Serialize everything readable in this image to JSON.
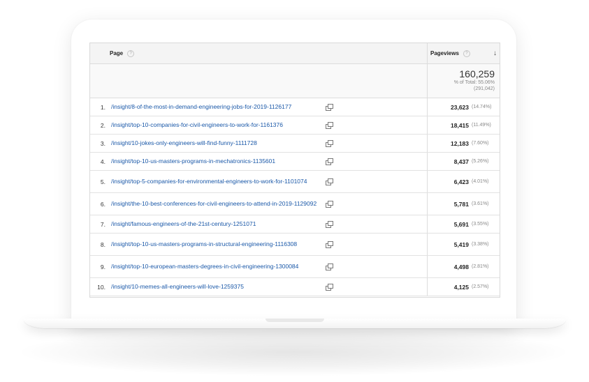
{
  "table": {
    "header": {
      "page_label": "Page",
      "metric_label": "Pageviews",
      "help_glyph": "?",
      "sort_glyph": "↓"
    },
    "total": {
      "value": "160,259",
      "percent_line": "% of Total: 55.06%",
      "total_line": "(291,042)"
    },
    "rows": [
      {
        "index": "1.",
        "page": "/insight/8-of-the-most-in-demand-engineering-jobs-for-2019-1126177",
        "views": "23,623",
        "pct": "(14.74%)"
      },
      {
        "index": "2.",
        "page": "/insight/top-10-companies-for-civil-engineers-to-work-for-1161376",
        "views": "18,415",
        "pct": "(11.49%)"
      },
      {
        "index": "3.",
        "page": "/insight/10-jokes-only-engineers-will-find-funny-1111728",
        "views": "12,183",
        "pct": "(7.60%)"
      },
      {
        "index": "4.",
        "page": "/insight/top-10-us-masters-programs-in-mechatronics-1135601",
        "views": "8,437",
        "pct": "(5.26%)"
      },
      {
        "index": "5.",
        "page": "/insight/top-5-companies-for-environmental-engineers-to-work-for-1101074",
        "views": "6,423",
        "pct": "(4.01%)"
      },
      {
        "index": "6.",
        "page": "/insight/the-10-best-conferences-for-civil-engineers-to-attend-in-2019-1129092",
        "views": "5,781",
        "pct": "(3.61%)"
      },
      {
        "index": "7.",
        "page": "/insight/famous-engineers-of-the-21st-century-1251071",
        "views": "5,691",
        "pct": "(3.55%)"
      },
      {
        "index": "8.",
        "page": "/insight/top-10-us-masters-programs-in-structural-engineering-1116308",
        "views": "5,419",
        "pct": "(3.38%)"
      },
      {
        "index": "9.",
        "page": "/insight/top-10-european-masters-degrees-in-civil-engineering-1300084",
        "views": "4,498",
        "pct": "(2.81%)"
      },
      {
        "index": "10.",
        "page": "/insight/10-memes-all-engineers-will-love-1259375",
        "views": "4,125",
        "pct": "(2.57%)"
      }
    ]
  }
}
